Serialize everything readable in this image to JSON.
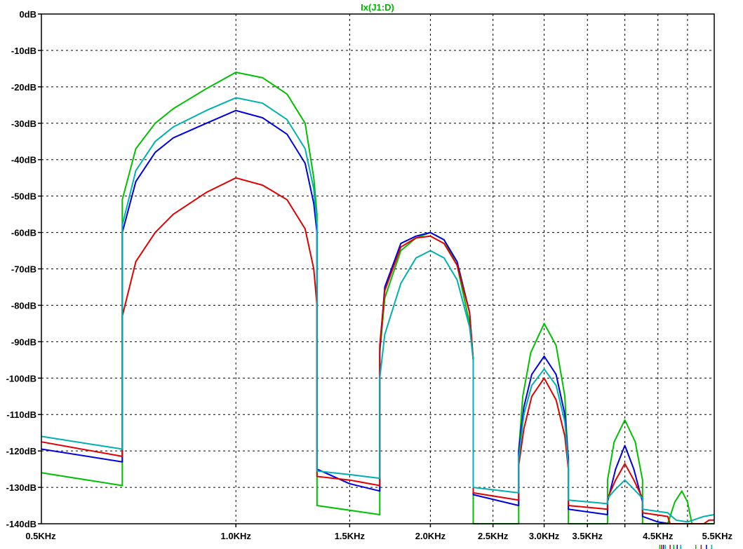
{
  "chart_data": {
    "type": "line",
    "title": "Ix(J1:D)",
    "title_color": "#00b400",
    "x_scale": "log",
    "xlim": [
      500,
      5500
    ],
    "ylim": [
      -140,
      0
    ],
    "grid": true,
    "y_ticks": [
      {
        "value": 0,
        "label": "0dB"
      },
      {
        "value": -10,
        "label": "-10dB"
      },
      {
        "value": -20,
        "label": "-20dB"
      },
      {
        "value": -30,
        "label": "-30dB"
      },
      {
        "value": -40,
        "label": "-40dB"
      },
      {
        "value": -50,
        "label": "-50dB"
      },
      {
        "value": -60,
        "label": "-60dB"
      },
      {
        "value": -70,
        "label": "-70dB"
      },
      {
        "value": -80,
        "label": "-80dB"
      },
      {
        "value": -90,
        "label": "-90dB"
      },
      {
        "value": -100,
        "label": "-100dB"
      },
      {
        "value": -110,
        "label": "-110dB"
      },
      {
        "value": -120,
        "label": "-120dB"
      },
      {
        "value": -130,
        "label": "-130dB"
      },
      {
        "value": -140,
        "label": "-140dB"
      }
    ],
    "x_ticks": [
      {
        "value": 500,
        "label": "0.5KHz"
      },
      {
        "value": 1000,
        "label": "1.0KHz"
      },
      {
        "value": 1500,
        "label": "1.5KHz"
      },
      {
        "value": 2000,
        "label": "2.0KHz"
      },
      {
        "value": 2500,
        "label": "2.5KHz"
      },
      {
        "value": 3000,
        "label": "3.0KHz"
      },
      {
        "value": 3500,
        "label": "3.5KHz"
      },
      {
        "value": 4500,
        "label": "4.5KHz"
      },
      {
        "value": 5500,
        "label": "5.5KHz"
      }
    ],
    "x_grid_only": [
      4000,
      5000
    ],
    "series": [
      {
        "color": "#00c000",
        "points": [
          [
            500,
            -126
          ],
          [
            667,
            -129.5
          ],
          [
            667,
            -51
          ],
          [
            700,
            -37
          ],
          [
            750,
            -30
          ],
          [
            800,
            -26
          ],
          [
            900,
            -20.5
          ],
          [
            1000,
            -16
          ],
          [
            1100,
            -17.5
          ],
          [
            1200,
            -22
          ],
          [
            1280,
            -30
          ],
          [
            1320,
            -45
          ],
          [
            1335,
            -55
          ],
          [
            1335,
            -135
          ],
          [
            1670,
            -137.5
          ],
          [
            1670,
            -93
          ],
          [
            1700,
            -78
          ],
          [
            1800,
            -65
          ],
          [
            1900,
            -61.5
          ],
          [
            2000,
            -60
          ],
          [
            2100,
            -62
          ],
          [
            2200,
            -69
          ],
          [
            2300,
            -85
          ],
          [
            2330,
            -95
          ],
          [
            2330,
            -140
          ],
          [
            2740,
            -140
          ],
          [
            2740,
            -120
          ],
          [
            2780,
            -105
          ],
          [
            2860,
            -93
          ],
          [
            3000,
            -85
          ],
          [
            3130,
            -91
          ],
          [
            3230,
            -105
          ],
          [
            3270,
            -125
          ],
          [
            3270,
            -140
          ],
          [
            3760,
            -140
          ],
          [
            3760,
            -128
          ],
          [
            3850,
            -117.5
          ],
          [
            4000,
            -111.5
          ],
          [
            4150,
            -117.5
          ],
          [
            4260,
            -128
          ],
          [
            4260,
            -140
          ],
          [
            4660,
            -140
          ],
          [
            4700,
            -138
          ],
          [
            4780,
            -134
          ],
          [
            4900,
            -131
          ],
          [
            5000,
            -134
          ],
          [
            5080,
            -140
          ],
          [
            5500,
            -140
          ]
        ]
      },
      {
        "color": "#0000e0",
        "points": [
          [
            500,
            -119.5
          ],
          [
            667,
            -123
          ],
          [
            667,
            -60
          ],
          [
            700,
            -46
          ],
          [
            750,
            -38
          ],
          [
            800,
            -34
          ],
          [
            900,
            -30
          ],
          [
            1000,
            -26.5
          ],
          [
            1100,
            -28.5
          ],
          [
            1200,
            -33
          ],
          [
            1280,
            -41
          ],
          [
            1320,
            -52
          ],
          [
            1335,
            -60
          ],
          [
            1335,
            -125
          ],
          [
            1500,
            -129
          ],
          [
            1670,
            -131
          ],
          [
            1670,
            -92
          ],
          [
            1700,
            -75
          ],
          [
            1800,
            -63
          ],
          [
            1900,
            -61
          ],
          [
            2000,
            -60
          ],
          [
            2100,
            -62
          ],
          [
            2200,
            -68
          ],
          [
            2300,
            -82
          ],
          [
            2330,
            -95
          ],
          [
            2330,
            -132
          ],
          [
            2740,
            -135
          ],
          [
            2740,
            -120
          ],
          [
            2790,
            -108
          ],
          [
            2870,
            -99
          ],
          [
            3000,
            -94
          ],
          [
            3130,
            -99
          ],
          [
            3230,
            -110
          ],
          [
            3270,
            -122
          ],
          [
            3270,
            -136
          ],
          [
            3760,
            -137.5
          ],
          [
            3760,
            -134
          ],
          [
            3870,
            -125
          ],
          [
            4000,
            -118.5
          ],
          [
            4130,
            -125
          ],
          [
            4260,
            -134
          ],
          [
            4260,
            -138
          ],
          [
            4500,
            -139.5
          ],
          [
            4700,
            -140
          ]
        ]
      },
      {
        "color": "#e00000",
        "points": [
          [
            500,
            -117.5
          ],
          [
            667,
            -121.5
          ],
          [
            667,
            -83
          ],
          [
            700,
            -68
          ],
          [
            750,
            -60
          ],
          [
            800,
            -55
          ],
          [
            900,
            -49
          ],
          [
            1000,
            -45
          ],
          [
            1100,
            -47
          ],
          [
            1200,
            -51
          ],
          [
            1280,
            -59
          ],
          [
            1320,
            -70
          ],
          [
            1335,
            -80
          ],
          [
            1335,
            -127
          ],
          [
            1500,
            -128
          ],
          [
            1670,
            -129.5
          ],
          [
            1670,
            -91
          ],
          [
            1700,
            -76
          ],
          [
            1800,
            -64
          ],
          [
            1900,
            -61.5
          ],
          [
            2000,
            -61
          ],
          [
            2100,
            -63
          ],
          [
            2200,
            -69
          ],
          [
            2300,
            -82
          ],
          [
            2330,
            -95
          ],
          [
            2330,
            -131.5
          ],
          [
            2740,
            -133.5
          ],
          [
            2740,
            -124
          ],
          [
            2790,
            -114
          ],
          [
            2870,
            -105
          ],
          [
            3000,
            -100
          ],
          [
            3130,
            -106
          ],
          [
            3230,
            -116
          ],
          [
            3270,
            -125
          ],
          [
            3270,
            -135
          ],
          [
            3760,
            -136
          ],
          [
            3760,
            -133
          ],
          [
            3870,
            -128
          ],
          [
            4000,
            -123.5
          ],
          [
            4130,
            -128
          ],
          [
            4260,
            -133
          ],
          [
            4260,
            -137
          ],
          [
            4660,
            -138
          ],
          [
            4700,
            -140
          ],
          [
            5300,
            -140
          ],
          [
            5400,
            -139
          ],
          [
            5500,
            -139
          ]
        ]
      },
      {
        "color": "#00b0b0",
        "points": [
          [
            500,
            -116
          ],
          [
            667,
            -119.5
          ],
          [
            667,
            -58
          ],
          [
            700,
            -43
          ],
          [
            750,
            -35
          ],
          [
            800,
            -31
          ],
          [
            900,
            -26.5
          ],
          [
            1000,
            -23
          ],
          [
            1100,
            -24.5
          ],
          [
            1200,
            -29
          ],
          [
            1280,
            -37
          ],
          [
            1320,
            -48
          ],
          [
            1335,
            -58
          ],
          [
            1335,
            -125.5
          ],
          [
            1500,
            -126.5
          ],
          [
            1670,
            -127.5
          ],
          [
            1670,
            -100
          ],
          [
            1700,
            -88
          ],
          [
            1800,
            -74
          ],
          [
            1900,
            -67
          ],
          [
            2000,
            -65
          ],
          [
            2100,
            -67
          ],
          [
            2200,
            -73
          ],
          [
            2300,
            -86
          ],
          [
            2330,
            -95
          ],
          [
            2330,
            -130
          ],
          [
            2740,
            -131.5
          ],
          [
            2740,
            -122
          ],
          [
            2790,
            -110
          ],
          [
            2870,
            -102
          ],
          [
            3000,
            -97.5
          ],
          [
            3130,
            -102
          ],
          [
            3230,
            -112
          ],
          [
            3270,
            -124
          ],
          [
            3270,
            -133.5
          ],
          [
            3760,
            -134.5
          ],
          [
            3760,
            -133
          ],
          [
            3870,
            -130.5
          ],
          [
            4000,
            -128
          ],
          [
            4130,
            -130.5
          ],
          [
            4260,
            -133
          ],
          [
            4260,
            -136
          ],
          [
            4660,
            -137
          ],
          [
            4800,
            -139
          ],
          [
            5000,
            -139.5
          ],
          [
            5300,
            -138
          ],
          [
            5500,
            -137.5
          ]
        ]
      }
    ]
  }
}
